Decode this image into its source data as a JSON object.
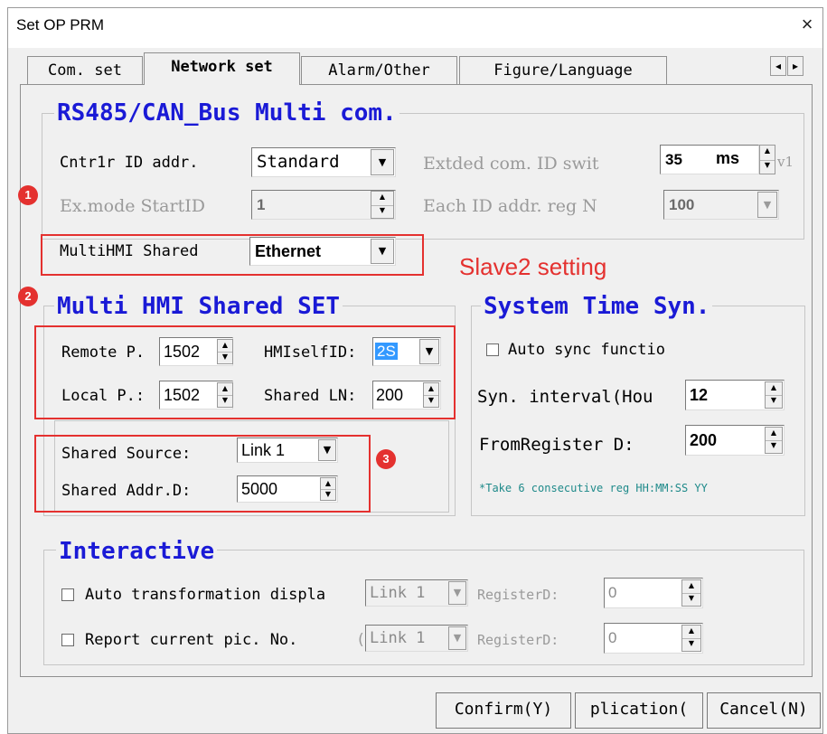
{
  "window": {
    "title": "Set OP PRM",
    "close": "×"
  },
  "tabs": [
    "Com. set",
    "Network set",
    "Alarm/Other",
    "Figure/Language"
  ],
  "tab_scroll": {
    "left": "◂",
    "right": "▸"
  },
  "rs485": {
    "title": "RS485/CAN_Bus Multi com.",
    "cntrlr_label": "Cntr1r ID addr.",
    "cntrlr_value": "Standard",
    "extded_label": "Extded com. ID swit",
    "extded_value": "35",
    "extded_unit": "ms",
    "extded_tail": "v1",
    "exmode_label": "Ex.mode StartID",
    "exmode_value": "1",
    "each_label": "Each ID addr. reg N",
    "each_value": "100",
    "multihmi_label": "MultiHMI Shared",
    "multihmi_value": "Ethernet"
  },
  "annotation": {
    "slave": "Slave2 setting",
    "badge1": "1",
    "badge2": "2",
    "badge3": "3"
  },
  "multi": {
    "title": "Multi HMI Shared SET",
    "remote_label": "Remote P.",
    "remote_value": "1502",
    "hmiself_label": "HMIselfID:",
    "hmiself_value": "2S",
    "local_label": "Local P.:",
    "local_value": "1502",
    "sharedln_label": "Shared LN:",
    "sharedln_value": "200",
    "source_label": "Shared Source:",
    "source_value": "Link 1",
    "addr_label": "Shared Addr.D:",
    "addr_value": "5000"
  },
  "systime": {
    "title": "System Time Syn.",
    "auto_label": "Auto sync functio",
    "interval_label": "Syn. interval(Hou",
    "interval_value": "12",
    "from_label": "FromRegister D:",
    "from_value": "200",
    "note": "*Take 6 consecutive reg HH:MM:SS YY"
  },
  "interactive": {
    "title": "Interactive",
    "auto_label": "Auto transformation displa",
    "auto_link": "Link 1",
    "auto_reg_label": "RegisterD:",
    "auto_reg_value": "0",
    "report_label": "Report current pic. No.",
    "report_paren": "(",
    "report_link": "Link 1",
    "report_reg_label": "RegisterD:",
    "report_reg_value": "0"
  },
  "buttons": {
    "confirm": "Confirm(Y)",
    "application": "plication(",
    "cancel": "Cancel(N)"
  },
  "colors": {
    "group_title": "#1a1ad6",
    "annotation_red": "#e4312f",
    "note_teal": "#1f8a8a",
    "selection": "#3399ff"
  }
}
